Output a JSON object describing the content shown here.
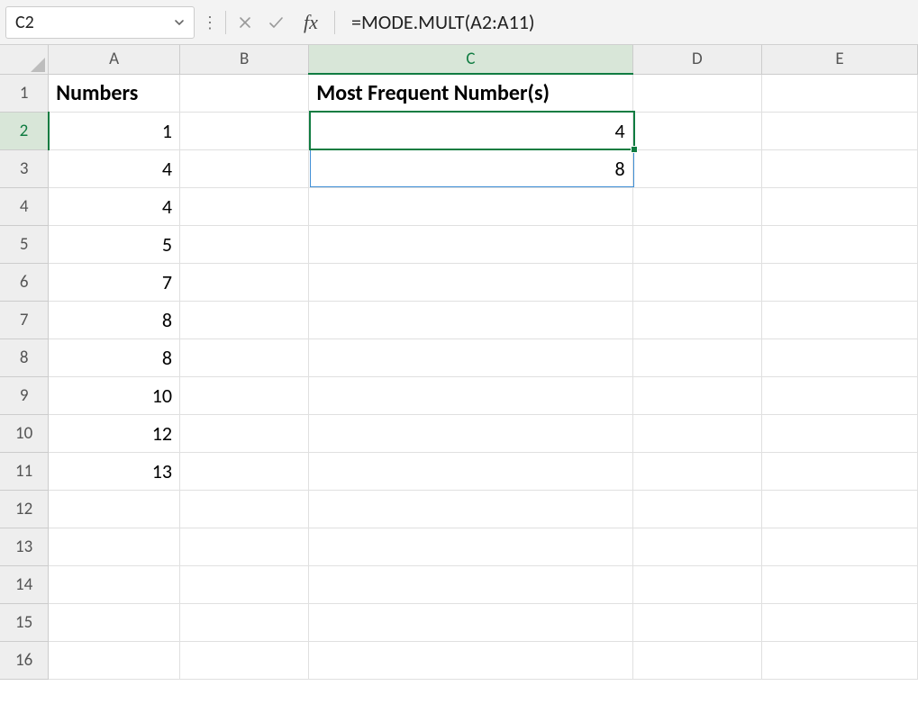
{
  "name_box": {
    "value": "C2"
  },
  "formula_input": {
    "value": "=MODE.MULT(A2:A11)"
  },
  "columns": [
    "A",
    "B",
    "C",
    "D",
    "E"
  ],
  "selected_column_index": 2,
  "selected_row_index": 1,
  "row_headers": [
    "1",
    "2",
    "3",
    "4",
    "5",
    "6",
    "7",
    "8",
    "9",
    "10",
    "11",
    "12",
    "13",
    "14",
    "15",
    "16"
  ],
  "cells": {
    "A1": "Numbers",
    "A2": "1",
    "A3": "4",
    "A4": "4",
    "A5": "5",
    "A6": "7",
    "A7": "8",
    "A8": "8",
    "A9": "10",
    "A10": "12",
    "A11": "13",
    "C1": "Most Frequent Number(s)",
    "C2": "4",
    "C3": "8"
  },
  "icons": {
    "cancel_glyph": "✕",
    "enter_glyph": "✓",
    "fx_glyph": "fx",
    "dots_glyph": "⋮"
  }
}
